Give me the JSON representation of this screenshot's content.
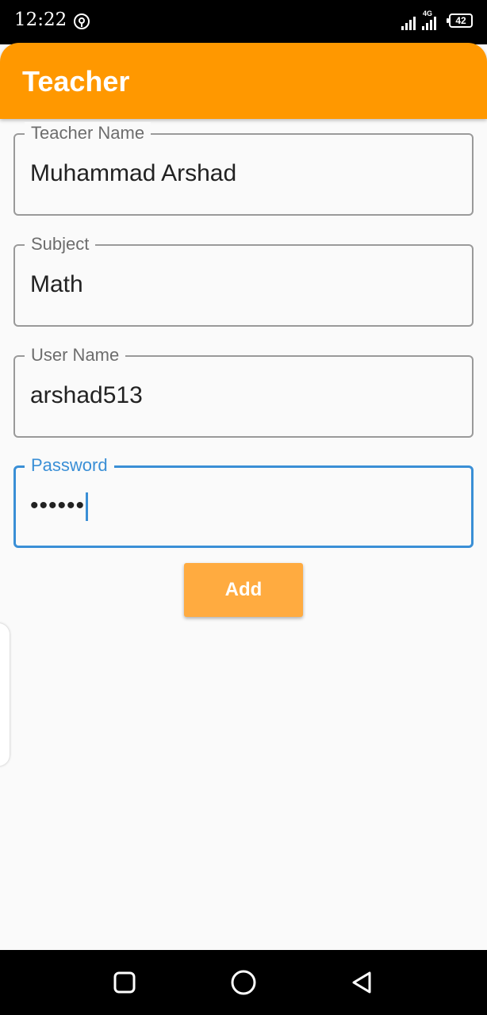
{
  "status_bar": {
    "time": "12:22",
    "network": "4G",
    "battery": "42",
    "icons": [
      "hotspot-icon",
      "signal-icon",
      "battery-icon"
    ]
  },
  "app_bar": {
    "title": "Teacher",
    "color": "#ff9800"
  },
  "form": {
    "fields": [
      {
        "label": "Teacher Name",
        "value": "Muhammad Arshad"
      },
      {
        "label": "Subject",
        "value": "Math"
      },
      {
        "label": "User Name",
        "value": "arshad513"
      },
      {
        "label": "Password",
        "value": "••••••",
        "focused": true
      }
    ],
    "add_label": "Add"
  },
  "nav_bar": {
    "icons": [
      "recents-icon",
      "home-icon",
      "back-icon"
    ]
  },
  "colors": {
    "accent": "#ff9800",
    "button": "#ffab40",
    "focus": "#3a8fd6"
  }
}
